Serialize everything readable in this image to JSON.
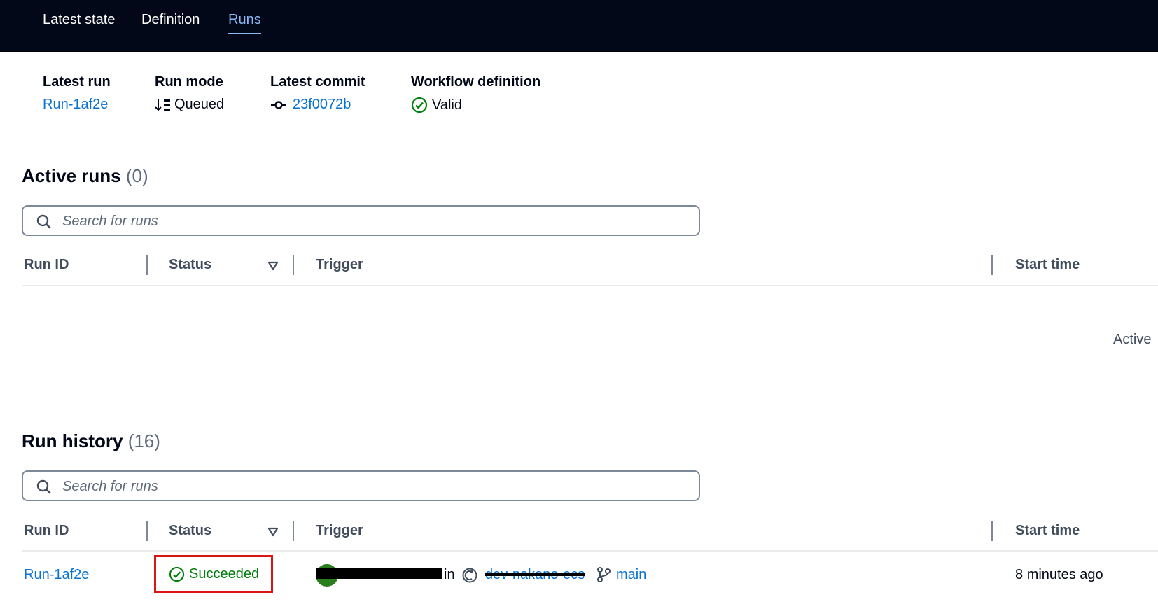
{
  "tabs": [
    {
      "label": "Latest state"
    },
    {
      "label": "Definition"
    },
    {
      "label": "Runs"
    }
  ],
  "summary": {
    "latest_run": {
      "label": "Latest run",
      "value": "Run-1af2e"
    },
    "run_mode": {
      "label": "Run mode",
      "value": "Queued"
    },
    "latest_commit": {
      "label": "Latest commit",
      "value": "23f0072b"
    },
    "workflow_definition": {
      "label": "Workflow definition",
      "value": "Valid"
    }
  },
  "active_runs": {
    "title": "Active runs",
    "count": "(0)",
    "search_placeholder": "Search for runs",
    "columns": [
      "Run ID",
      "Status",
      "Trigger",
      "Start time"
    ],
    "empty_text": "Active"
  },
  "run_history": {
    "title": "Run history",
    "count": "(16)",
    "search_placeholder": "Search for runs",
    "columns": [
      "Run ID",
      "Status",
      "Trigger",
      "Start time"
    ],
    "rows": [
      {
        "run_id": "Run-1af2e",
        "status": "Succeeded",
        "trigger_in": "in",
        "repo": "dev-nakano-ecs",
        "branch": "main",
        "start_time": "8 minutes ago"
      }
    ]
  },
  "colors": {
    "topbar_bg": "#020817",
    "link": "#0972d3",
    "success": "#037f0c",
    "highlight_box": "#d91515"
  },
  "icons": [
    "search-icon",
    "sort-desc-icon",
    "commit-icon",
    "check-circle-icon",
    "filter-triangle-icon",
    "repository-icon",
    "branch-icon",
    "avatar"
  ]
}
